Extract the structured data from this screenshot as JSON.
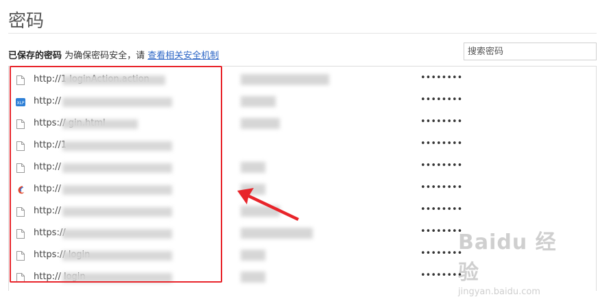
{
  "page": {
    "title": "密码"
  },
  "info": {
    "label": "已保存的密码",
    "text": " 为确保密码安全，请 ",
    "link": "查看相关安全机制"
  },
  "search": {
    "placeholder": "搜索密码"
  },
  "rows": [
    {
      "url": "http://1                    loginAction.action",
      "icon": "file-icon",
      "user_width": 0.43,
      "password": "••••••••"
    },
    {
      "url": "http://",
      "icon": "xlp-icon",
      "user_width": 0.17,
      "password": "••••••••"
    },
    {
      "url": "https://                     gin.html",
      "icon": "file-icon",
      "user_width": 0.19,
      "password": "••••••••"
    },
    {
      "url": "http://1",
      "icon": "file-icon",
      "user_width": 0.0,
      "password": "••••••••"
    },
    {
      "url": "http://",
      "icon": "file-icon",
      "user_width": 0.12,
      "password": "••••••••"
    },
    {
      "url": "http://",
      "icon": "swirl-icon",
      "user_width": 0.12,
      "password": "••••••••"
    },
    {
      "url": "http://",
      "icon": "file-icon",
      "user_width": 0.19,
      "password": "••••••••"
    },
    {
      "url": "https://",
      "icon": "file-icon",
      "user_width": 0.35,
      "password": "••••••••"
    },
    {
      "url": "https://                          login",
      "icon": "file-icon",
      "user_width": 0.12,
      "password": "••••••••"
    },
    {
      "url": "http://                            login",
      "icon": "file-icon",
      "user_width": 0.12,
      "password": "••••••••"
    }
  ],
  "watermark": {
    "logo": "Baidu 经验",
    "sub": "jingyan.baidu.com"
  },
  "colors": {
    "highlight": "#e8242a",
    "link": "#2a64c5"
  }
}
